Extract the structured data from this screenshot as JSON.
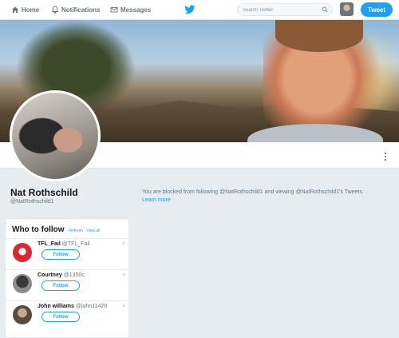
{
  "nav": {
    "home": "Home",
    "notifications": "Notifications",
    "messages": "Messages",
    "search_placeholder": "Search Twitter",
    "tweet_button": "Tweet"
  },
  "profile": {
    "display_name": "Nat Rothschild",
    "screen_name": "@NatRothschild1",
    "blocked_message": "You are blocked from following @NatRothschild1 and viewing @NatRothschild1's Tweets.",
    "learn_more": "Learn more"
  },
  "who_to_follow": {
    "title": "Who to follow",
    "separator": " · ",
    "refresh": "Refresh",
    "view_all": "View all",
    "follow_label": "Follow",
    "dismiss": "×",
    "suggestions": [
      {
        "name": "TFL_Fail",
        "handle": "@TFL_Fail"
      },
      {
        "name": "Courtney",
        "handle": "@1350c"
      },
      {
        "name": "John williams",
        "handle": "@john11428"
      }
    ]
  },
  "colors": {
    "accent": "#1da1f2",
    "background": "#e6ecf0"
  }
}
